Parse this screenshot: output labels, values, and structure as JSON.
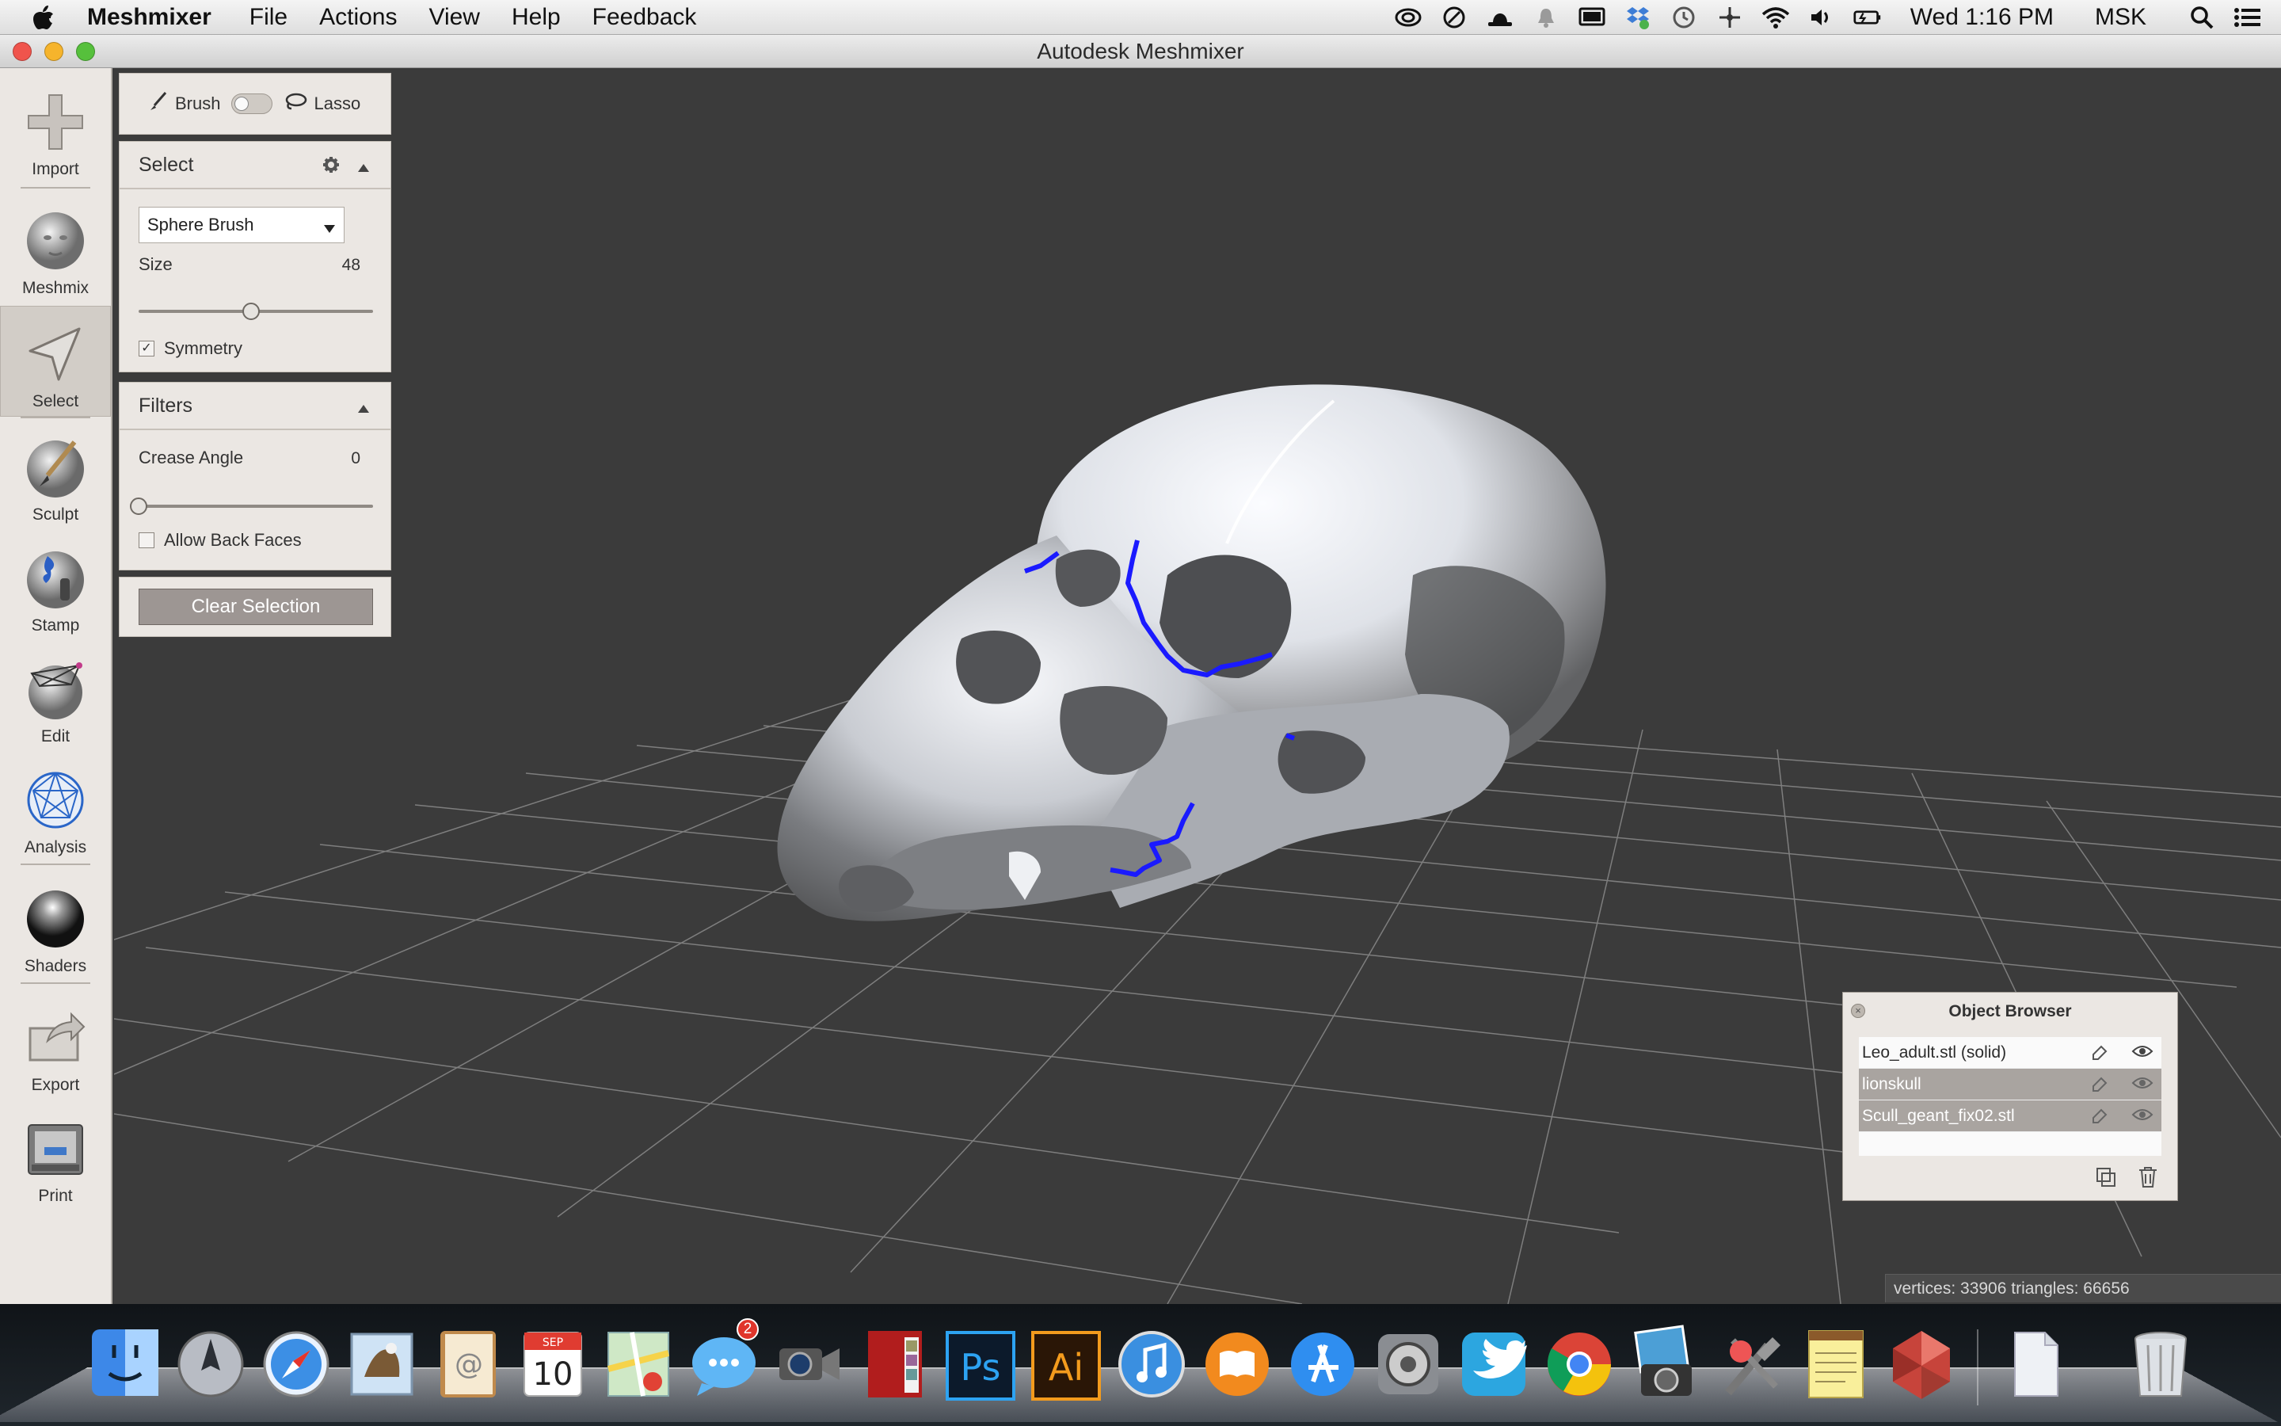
{
  "menubar": {
    "app_name": "Meshmixer",
    "items": [
      "File",
      "Actions",
      "View",
      "Help",
      "Feedback"
    ],
    "clock": "Wed 1:16 PM",
    "user": "MSK"
  },
  "window": {
    "title": "Autodesk Meshmixer"
  },
  "tools": [
    {
      "label": "Import",
      "icon": "plus-icon"
    },
    {
      "label": "Meshmix",
      "icon": "meshmix-head-icon"
    },
    {
      "label": "Select",
      "icon": "select-arrow-icon",
      "active": true
    },
    {
      "label": "Sculpt",
      "icon": "brush-icon"
    },
    {
      "label": "Stamp",
      "icon": "stamp-icon"
    },
    {
      "label": "Edit",
      "icon": "edit-mesh-icon"
    },
    {
      "label": "Analysis",
      "icon": "analysis-sphere-icon"
    },
    {
      "label": "Shaders",
      "icon": "shader-sphere-icon"
    },
    {
      "label": "Export",
      "icon": "export-icon"
    },
    {
      "label": "Print",
      "icon": "printer-icon"
    }
  ],
  "brush_mode": {
    "brush_label": "Brush",
    "lasso_label": "Lasso"
  },
  "select_panel": {
    "title": "Select",
    "brush_type": "Sphere Brush",
    "size_label": "Size",
    "size_value": "48",
    "size_fraction": 0.48,
    "symmetry_label": "Symmetry",
    "symmetry_checked": true
  },
  "filters_panel": {
    "title": "Filters",
    "crease_label": "Crease Angle",
    "crease_value": "0",
    "crease_fraction": 0,
    "back_faces_label": "Allow Back Faces",
    "back_faces_checked": false
  },
  "clear_button": "Clear Selection",
  "object_browser": {
    "title": "Object Browser",
    "objects": [
      {
        "name": "Leo_adult.stl (solid)",
        "selected": false
      },
      {
        "name": "lionskull",
        "selected": true
      },
      {
        "name": "Scull_geant_fix02.stl",
        "selected": true
      }
    ]
  },
  "status": {
    "text": "vertices: 33906 triangles: 66656"
  },
  "dock": {
    "messages_badge": "2",
    "calendar_month": "SEP",
    "calendar_day": "10",
    "ps_label": "Ps",
    "ai_label": "Ai"
  },
  "colors": {
    "viewport_bg": "#3b3b3b",
    "panel_bg": "#ebe7e3",
    "selection_blue": "#1a1aff",
    "clear_button": "#9d9693"
  }
}
